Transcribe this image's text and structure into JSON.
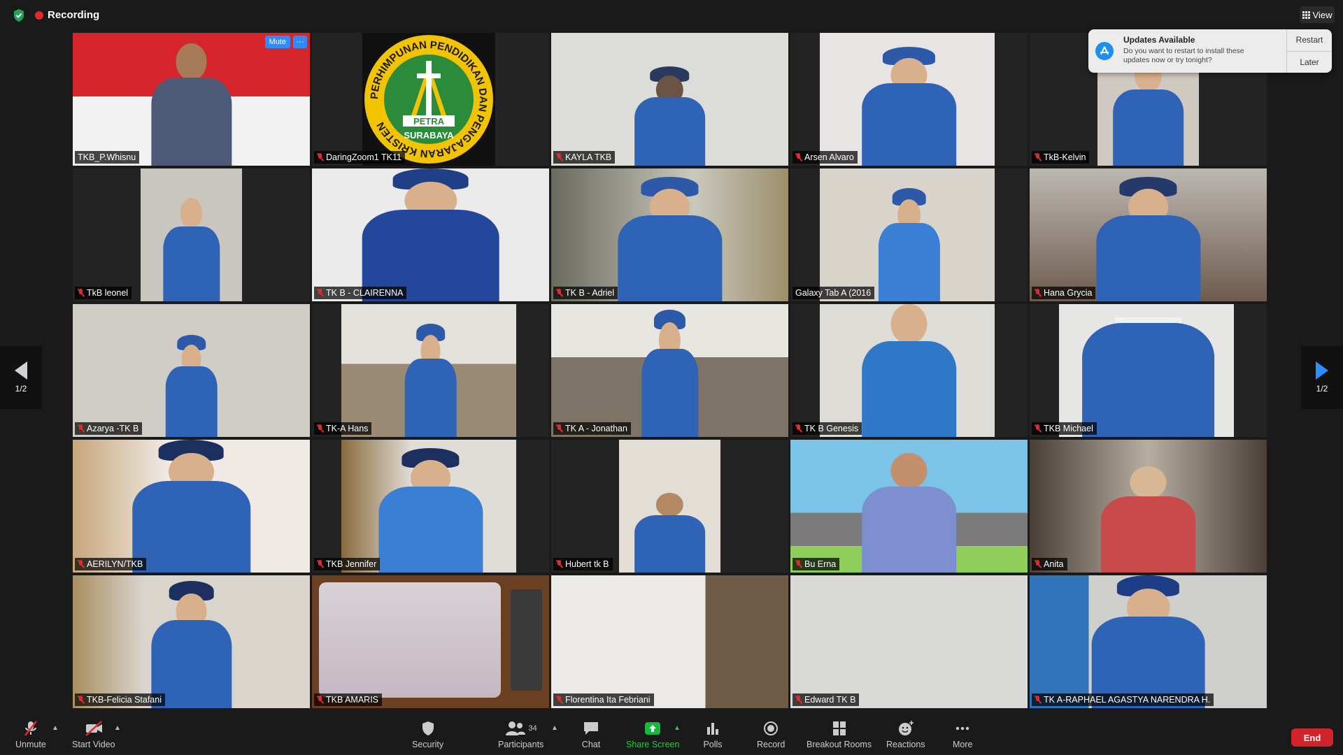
{
  "topbar": {
    "recording_label": "Recording",
    "view_label": "View"
  },
  "notification": {
    "title": "Updates Available",
    "message": "Do you want to restart to install these updates now or try tonight?",
    "restart_label": "Restart",
    "later_label": "Later"
  },
  "pager": {
    "left_label": "1/2",
    "right_label": "1/2"
  },
  "tiles": [
    {
      "name": "TKB_P.Whisnu",
      "active": true,
      "muted": false,
      "mute_label": "Mute",
      "more_label": "···"
    },
    {
      "name": "DaringZoom1 TK11",
      "muted": true,
      "logo_top": "PERHIMPUNAN PENDIDIKAN DAN PENGAJARAN KRISTEN",
      "logo_center": "PETRA",
      "logo_city": "SURABAYA"
    },
    {
      "name": "KAYLA TKB",
      "muted": true
    },
    {
      "name": "Arsen Alvaro",
      "muted": true
    },
    {
      "name": "TkB-Kelvin",
      "muted": true
    },
    {
      "name": "TkB leonel",
      "muted": true
    },
    {
      "name": "TK B - CLAIRENNA",
      "muted": true
    },
    {
      "name": "TK B - Adriel",
      "muted": true
    },
    {
      "name": "Galaxy Tab A (2016",
      "muted": false
    },
    {
      "name": "Hana Grycia",
      "muted": true
    },
    {
      "name": "Azarya -TK B",
      "muted": true
    },
    {
      "name": "TK-A Hans",
      "muted": true
    },
    {
      "name": "TK A - Jonathan",
      "muted": true
    },
    {
      "name": "TK B Genesis",
      "muted": true
    },
    {
      "name": "TKB Michael",
      "muted": true
    },
    {
      "name": "AERILYN/TKB",
      "muted": true
    },
    {
      "name": "TKB Jennifer",
      "muted": true
    },
    {
      "name": "Hubert tk B",
      "muted": true
    },
    {
      "name": "Bu Erna",
      "muted": true
    },
    {
      "name": "Anita",
      "muted": true
    },
    {
      "name": "TKB-Felicia Stafani",
      "muted": true
    },
    {
      "name": "TKB AMARIS",
      "muted": true
    },
    {
      "name": "Florentina Ita Febriani",
      "muted": true
    },
    {
      "name": "Edward TK B",
      "muted": true
    },
    {
      "name": "TK A-RAPHAEL AGASTYA NARENDRA H.",
      "muted": true
    }
  ],
  "toolbar": {
    "unmute_label": "Unmute",
    "start_video_label": "Start Video",
    "security_label": "Security",
    "participants_label": "Participants",
    "participants_count": "34",
    "chat_label": "Chat",
    "share_screen_label": "Share Screen",
    "polls_label": "Polls",
    "record_label": "Record",
    "breakout_label": "Breakout Rooms",
    "reactions_label": "Reactions",
    "more_label": "More",
    "end_label": "End"
  },
  "colors": {
    "accent": "#2d8cff",
    "active_border": "#e4e36b",
    "recording": "#e5292b",
    "share_green": "#18b83b",
    "end_red": "#d1232a"
  }
}
